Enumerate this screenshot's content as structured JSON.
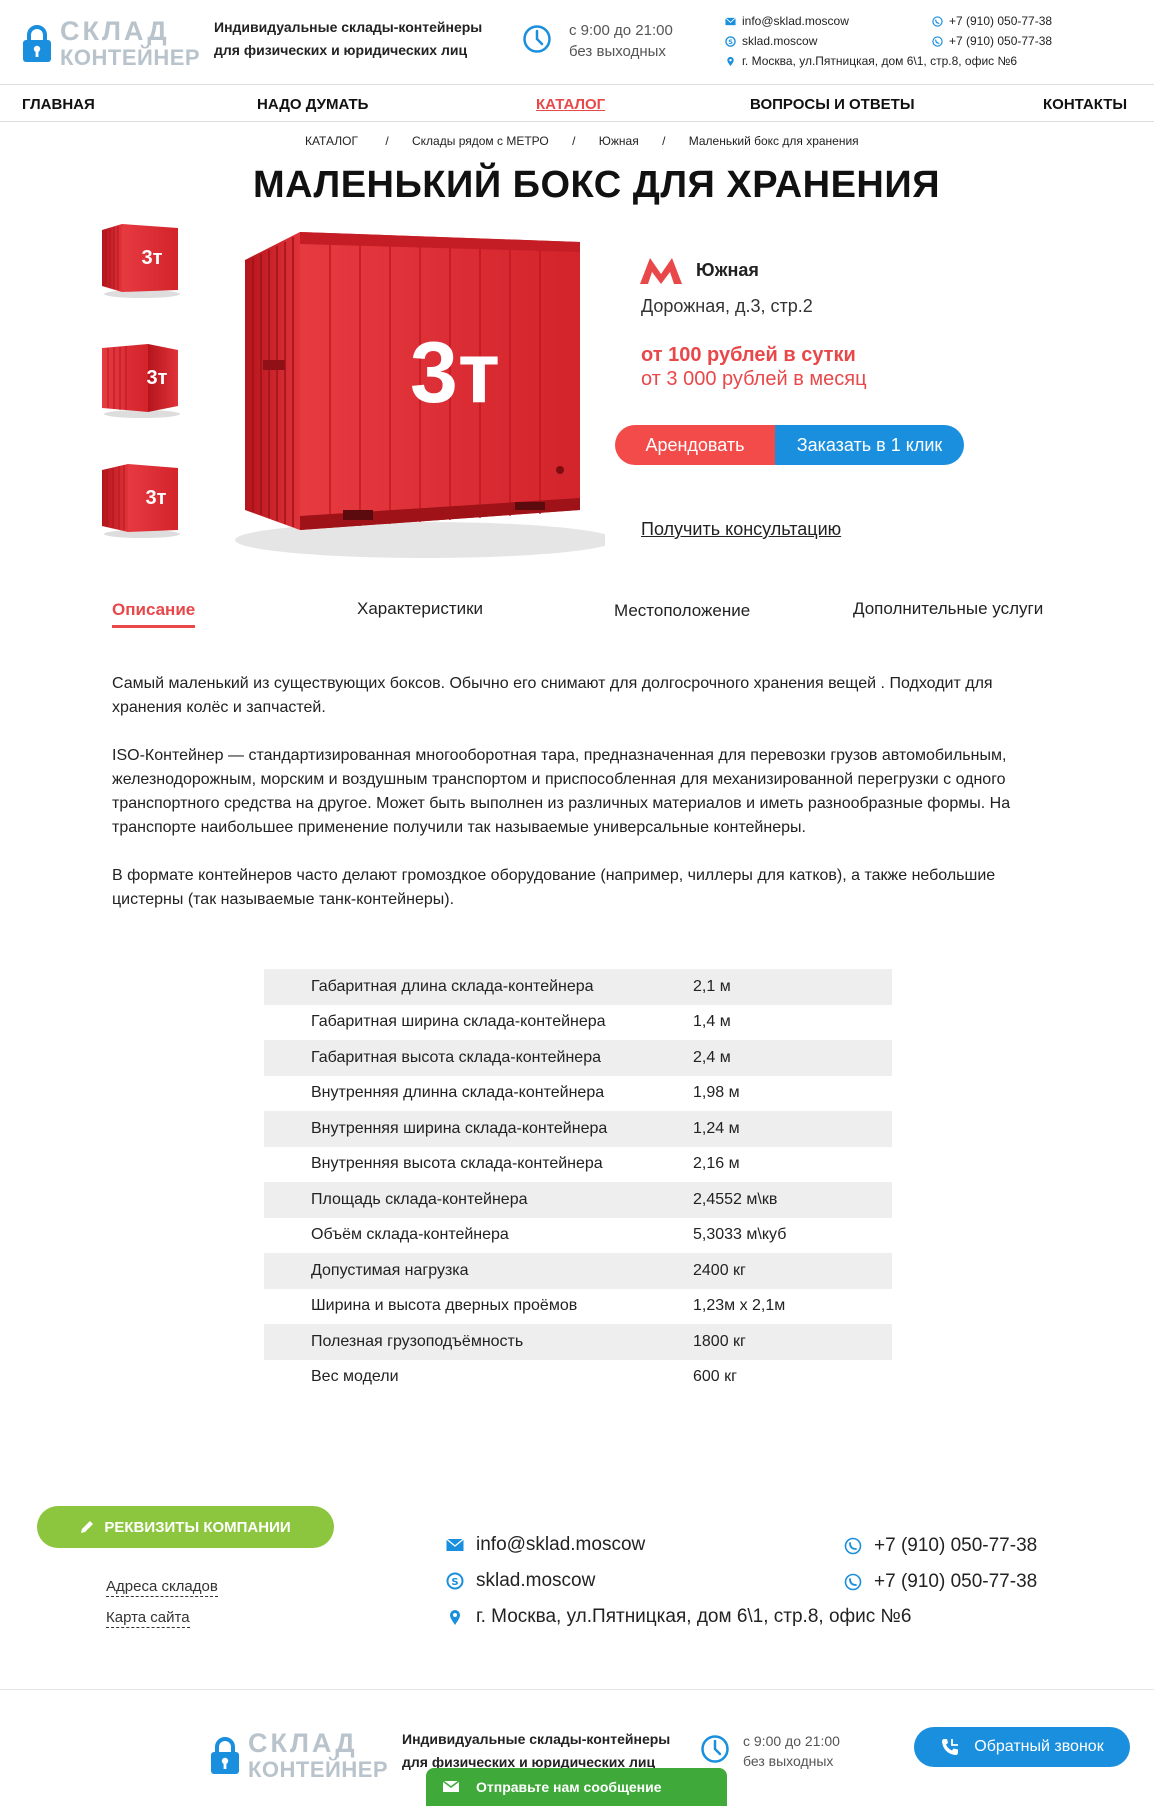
{
  "header": {
    "logo": {
      "line1": "СКЛАД",
      "line2": "КОНТЕЙНЕР"
    },
    "tagline": {
      "line1": "Индивидуальные склады-контейнеры",
      "line2": "для физических и юридических лиц"
    },
    "hours": {
      "line1": "с 9:00 до 21:00",
      "line2": "без выходных"
    },
    "email": "info@sklad.moscow",
    "skype": "sklad.moscow",
    "address": "г. Москва, ул.Пятницкая, дом 6\\1, стр.8, офис №6",
    "phone1": "+7 (910) 050-77-38",
    "phone2": "+7 (910) 050-77-38"
  },
  "nav": {
    "items": [
      {
        "label": "ГЛАВНАЯ"
      },
      {
        "label": "НАДО ДУМАТЬ"
      },
      {
        "label": "КАТАЛОГ"
      },
      {
        "label": "ВОПРОСЫ И ОТВЕТЫ"
      },
      {
        "label": "КОНТАКТЫ"
      }
    ],
    "active": "КАТАЛОГ"
  },
  "breadcrumb": {
    "items": [
      "КАТАЛОГ",
      "Склады рядом с МЕТРО",
      "Южная",
      "Маленький бокс для хранения"
    ],
    "separator": "/"
  },
  "page_title": "МАЛЕНЬКИЙ БОКС ДЛЯ ХРАНЕНИЯ",
  "product": {
    "container_label": "3т",
    "metro_station": "Южная",
    "address": "Дорожная, д.3, стр.2",
    "price_day": "от 100 рублей в сутки",
    "price_month": "от 3 000 рублей в месяц",
    "rent_button": "Арендовать",
    "order_button": "Заказать в 1 клик",
    "consult_link": "Получить консультацию",
    "colors": {
      "container": "#d8242b",
      "accent": "#e8484a",
      "blue": "#1a8fde"
    }
  },
  "tabs": [
    {
      "label": "Описание"
    },
    {
      "label": "Характеристики"
    },
    {
      "label": "Местоположение"
    },
    {
      "label": "Дополнительные услуги"
    }
  ],
  "description": {
    "p1": "Самый маленький из существующих боксов. Обычно его снимают для долгосрочного хранения вещей . Подходит для хранения колёс и запчастей.",
    "p2": "ISO-Контейнер — стандартизированная многооборотная тара, предназначенная для перевозки грузов автомобильным, железнодорожным, морским и воздушным транспортом и приспособленная для механизированной перегрузки с одного транспортного средства на другое. Может быть выполнен из различных материалов и иметь разнообразные формы. На транспорте наибольшее применение получили так называемые универсальные контейнеры.",
    "p3": "В формате контейнеров часто делают громоздкое оборудование (например, чиллеры для катков), а также небольшие цистерны (так называемые танк-контейнеры)."
  },
  "specs": [
    {
      "k": "Габаритная длина склада-контейнера",
      "v": "2,1 м"
    },
    {
      "k": "Габаритная ширина склада-контейнера",
      "v": "1,4 м"
    },
    {
      "k": "Габаритная высота склада-контейнера",
      "v": "2,4 м"
    },
    {
      "k": "Внутренняя длинна склада-контейнера",
      "v": "1,98 м"
    },
    {
      "k": "Внутренняя ширина склада-контейнера",
      "v": "1,24 м"
    },
    {
      "k": "Внутренняя высота склада-контейнера",
      "v": "2,16 м"
    },
    {
      "k": "Площадь склада-контейнера",
      "v": "2,4552 м\\кв"
    },
    {
      "k": "Объём склада-контейнера",
      "v": "5,3033 м\\куб"
    },
    {
      "k": "Допустимая нагрузка",
      "v": "2400 кг"
    },
    {
      "k": "Ширина и высота дверных проёмов",
      "v": "1,23м х 2,1м"
    },
    {
      "k": "Полезная грузоподъёмность",
      "v": "1800 кг"
    },
    {
      "k": "Вес модели",
      "v": "600 кг"
    }
  ],
  "footer": {
    "requisites_button": "РЕКВИЗИТЫ КОМПАНИИ",
    "link_warehouses": "Адреса складов",
    "link_sitemap": "Карта сайта",
    "email": "info@sklad.moscow",
    "skype": "sklad.moscow",
    "address": "г. Москва, ул.Пятницкая, дом 6\\1, стр.8, офис №6",
    "phone1": "+7 (910) 050-77-38",
    "phone2": "+7 (910) 050-77-38",
    "callback_button": "Обратный звонок",
    "message_bar": "Отправьте нам сообщение"
  },
  "icons": [
    "lock-icon",
    "clock-icon",
    "mail-icon",
    "skype-icon",
    "location-icon",
    "whatsapp-icon",
    "metro-icon",
    "pencil-icon",
    "phone-icon",
    "chat-icon"
  ]
}
